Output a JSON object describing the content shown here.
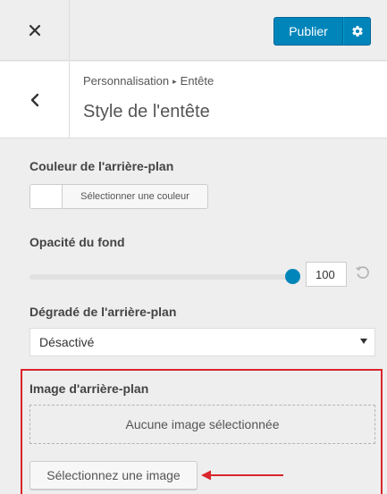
{
  "topbar": {
    "close_icon": "close-icon",
    "publish_label": "Publier",
    "settings_icon": "gear-icon",
    "accent_color": "#0085ba"
  },
  "section": {
    "back_icon": "chevron-left-icon",
    "breadcrumb_root": "Personnalisation",
    "breadcrumb_separator": "▸",
    "breadcrumb_current": "Entête",
    "title": "Style de l'entête"
  },
  "controls": {
    "background_color": {
      "label": "Couleur de l'arrière-plan",
      "button_label": "Sélectionner une couleur"
    },
    "opacity": {
      "label": "Opacité du fond",
      "value": "100",
      "slider_fraction": 1.0,
      "reset_icon": "reset-icon"
    },
    "gradient": {
      "label": "Dégradé de l'arrière-plan",
      "selected": "Désactivé"
    },
    "background_image": {
      "label": "Image d'arrière-plan",
      "placeholder": "Aucune image sélectionnée",
      "button_label": "Sélectionnez une image",
      "highlight_color": "#d9262c"
    }
  }
}
